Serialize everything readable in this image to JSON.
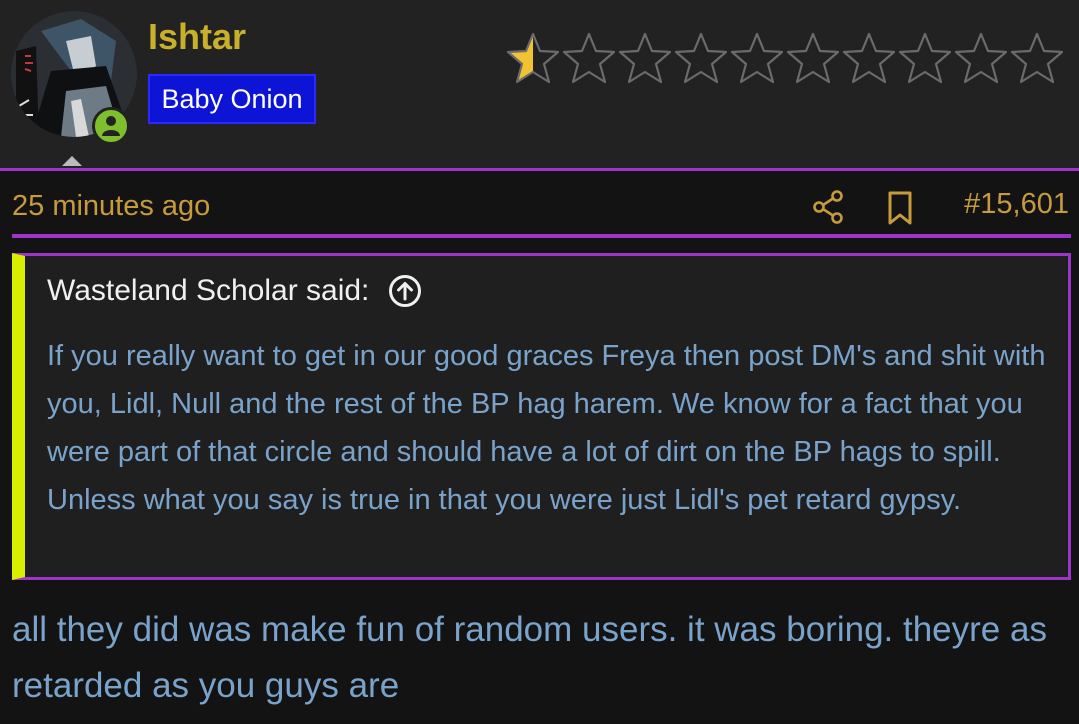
{
  "user": {
    "name": "Ishtar",
    "title_badge": "Baby Onion",
    "online_indicator": "user-icon"
  },
  "rating": {
    "total_stars": 10,
    "value": 0.5
  },
  "post": {
    "time": "25 minutes ago",
    "number": "#15,601",
    "share_icon": "share-icon",
    "bookmark_icon": "bookmark-icon",
    "quote": {
      "author_line": "Wasteland Scholar said:",
      "jump_icon": "arrow-up-circle-icon",
      "text": "If you really want to get in our good graces Freya then post DM's and shit with you, Lidl, Null and the rest of the BP hag harem. We know for a fact that you were part of that circle and should have a lot of dirt on the BP hags to spill. Unless what you say is true in that you were just Lidl's pet retard gypsy."
    },
    "body": "all they did was make fun of random users. it was boring. theyre as retarded as you guys are"
  },
  "colors": {
    "username": "#c9b02a",
    "badge_bg": "#0d14d6",
    "accent_purple": "#9c35c8",
    "quote_bar": "#d8f000",
    "body_text": "#7aa3cc",
    "meta_text": "#c79a3c",
    "star_fill": "#f1c232"
  }
}
